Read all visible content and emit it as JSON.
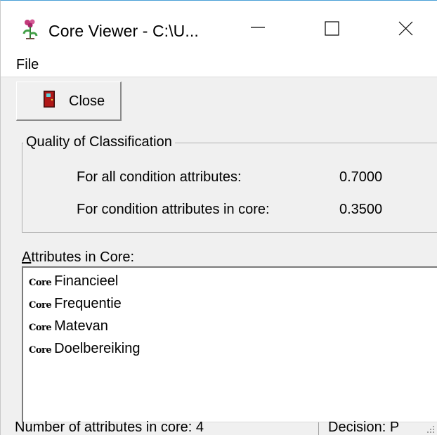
{
  "window": {
    "title": "Core Viewer - C:\\U...",
    "icon": "flower-app-icon",
    "controls": {
      "minimize_icon": "minimize-icon",
      "maximize_icon": "maximize-icon",
      "close_icon": "close-icon"
    }
  },
  "menubar": {
    "items": [
      {
        "label": "File"
      }
    ]
  },
  "toolbar": {
    "close_label": "Close",
    "close_icon": "door-icon",
    "close_icon_color": "#b01818"
  },
  "quality": {
    "legend": "Quality of Classification",
    "rows": [
      {
        "label": "For all condition attributes:",
        "value": "0.7000"
      },
      {
        "label": "For condition attributes in core:",
        "value": "0.3500"
      }
    ]
  },
  "attributes": {
    "label": "Attributes in Core:",
    "label_accelerator": "A",
    "label_rest": "ttributes in Core:",
    "items": [
      {
        "tag": "Core",
        "name": "Financieel"
      },
      {
        "tag": "Core",
        "name": "Frequentie"
      },
      {
        "tag": "Core",
        "name": "Matevan"
      },
      {
        "tag": "Core",
        "name": "Doelbereiking"
      }
    ]
  },
  "statusbar": {
    "left": "Number of attributes in core: 4",
    "right": "Decision: P"
  }
}
